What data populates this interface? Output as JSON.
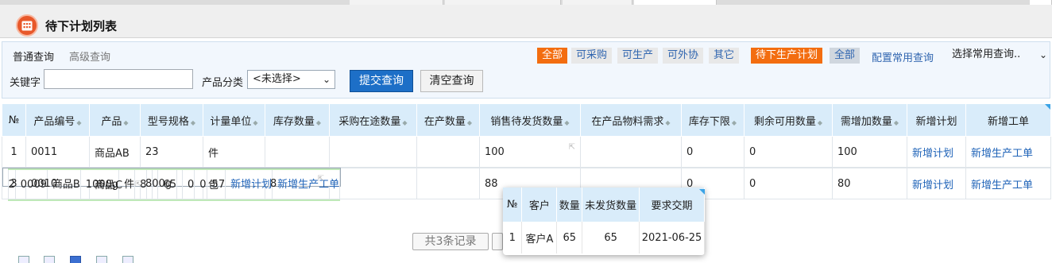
{
  "page": {
    "title": "待下计划列表"
  },
  "query": {
    "tabs": [
      "普通查询",
      "高级查询"
    ],
    "keyword_label": "关键字",
    "keyword_value": "",
    "category_label": "产品分类",
    "category_value": "<未选择>",
    "submit": "提交查询",
    "clear": "清空查询",
    "filters1": [
      "全部",
      "可采购",
      "可生产",
      "可外协",
      "其它"
    ],
    "filters2": [
      "待下生产计划",
      "全部"
    ],
    "config_link": "配置常用查询",
    "common_select": "选择常用查询.."
  },
  "table": {
    "headers": [
      "№",
      "产品编号",
      "产品",
      "型号规格",
      "计量单位",
      "库存数量",
      "采购在途数量",
      "在产数量",
      "销售待发货数量",
      "在产品物料需求",
      "库存下限",
      "剩余可用数量",
      "需增加数量",
      "新增计划",
      "新增工单"
    ],
    "rows": [
      [
        "1",
        "0011",
        "商品AB",
        "23",
        "件",
        "",
        "",
        "",
        "100",
        "",
        "0",
        "0",
        "100",
        "新增计划",
        "新增生产工单"
      ],
      [
        "2",
        "0009",
        "商品B",
        "1000g",
        "件",
        "8",
        "",
        "",
        "65",
        "",
        "0",
        "0",
        "57",
        "新增计划",
        "新增生产工单"
      ],
      [
        "3",
        "0010",
        "商品C",
        "800g",
        "包",
        "8",
        "",
        "",
        "88",
        "",
        "0",
        "0",
        "80",
        "新增计划",
        "新增生产工单"
      ]
    ]
  },
  "pager": {
    "summary": "共3条记录"
  },
  "popup": {
    "headers": [
      "№",
      "客户",
      "数量",
      "未发货数量",
      "要求交期"
    ],
    "rows": [
      [
        "1",
        "客户A",
        "65",
        "65",
        "2021-06-25"
      ]
    ]
  },
  "colors": {
    "accent": "#f36d10",
    "primary": "#1d6fc7",
    "header_bg": "#d9ecfa",
    "link": "#1f63b8"
  }
}
